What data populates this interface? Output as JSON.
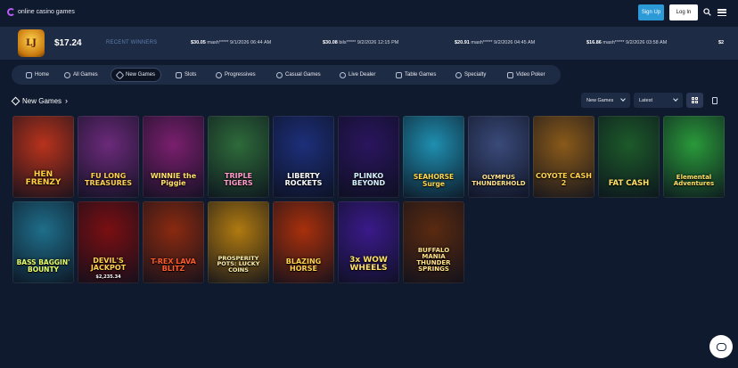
{
  "brand": {
    "name": "online casino games"
  },
  "header": {
    "signup": "Sign Up",
    "login": "Log In"
  },
  "jackpot": {
    "badge": "LJ",
    "amount": "$17.24"
  },
  "winners": {
    "label": "RECENT WINNERS",
    "items": [
      {
        "amount": "$30.05",
        "detail": "mash***** 9/1/2026 06:44 AM"
      },
      {
        "amount": "$30.08",
        "detail": "bils***** 9/2/2026 12:15 PM"
      },
      {
        "amount": "$20.91",
        "detail": "mash***** 9/2/2026 04:45 AM"
      },
      {
        "amount": "$16.86",
        "detail": "mash***** 9/2/2026 03:58 AM"
      },
      {
        "amount": "$2",
        "detail": ""
      }
    ]
  },
  "nav": {
    "items": [
      {
        "label": "Home"
      },
      {
        "label": "All Games"
      },
      {
        "label": "New Games"
      },
      {
        "label": "Slots"
      },
      {
        "label": "Progressives"
      },
      {
        "label": "Casual Games"
      },
      {
        "label": "Live Dealer"
      },
      {
        "label": "Table Games"
      },
      {
        "label": "Specialty"
      },
      {
        "label": "Video Poker"
      }
    ]
  },
  "section": {
    "title": "New Games",
    "filter": "New Games",
    "sort": "Latest"
  },
  "games": [
    {
      "title": "HEN FRENZY",
      "color": "#b8331c"
    },
    {
      "title": "FU LONG TREASURES",
      "color": "#6b2a7a"
    },
    {
      "title": "WINNIE the Piggie",
      "color": "#7a1f6e"
    },
    {
      "title": "TRIPLE TIGERS",
      "color": "#2e6b3a"
    },
    {
      "title": "LIBERTY ROCKETS",
      "color": "#1d2f7a"
    },
    {
      "title": "PLINKO BEYOND",
      "color": "#2a155e"
    },
    {
      "title": "SEAHORSE Surge",
      "color": "#1f8fb0"
    },
    {
      "title": "OLYMPUS THUNDERHOLD",
      "color": "#3a4a7a"
    },
    {
      "title": "COYOTE CASH 2",
      "color": "#8a5a1a"
    },
    {
      "title": "FAT CASH",
      "color": "#1d5a2a"
    },
    {
      "title": "Elemental Adventures",
      "color": "#2a9a3a"
    },
    {
      "title": "BASS BAGGIN' BOUNTY",
      "color": "#1f6e8a"
    },
    {
      "title": "DEVIL'S JACKPOT",
      "subtitle": "$2,235.34",
      "color": "#7a0f12"
    },
    {
      "title": "T-REX LAVA BLITZ",
      "color": "#8a2a10"
    },
    {
      "title": "PROSPERITY POTS: LUCKY COINS",
      "color": "#b07a10"
    },
    {
      "title": "BLAZING HORSE",
      "color": "#a8300c"
    },
    {
      "title": "3x WOW WHEELS",
      "color": "#3a1a8a"
    },
    {
      "title": "BUFFALO MANIA THUNDER SPRINGS",
      "color": "#5a2a10"
    }
  ]
}
